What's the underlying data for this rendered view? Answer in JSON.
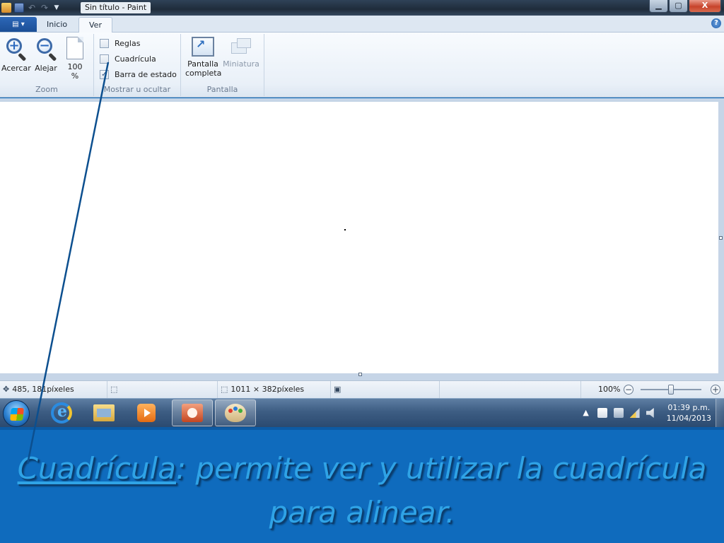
{
  "window": {
    "title": "Sin título - Paint",
    "controls": {
      "minimize": "▁",
      "maximize": "▢",
      "close": "X"
    }
  },
  "ribbon": {
    "tabs": [
      {
        "label": "Inicio"
      },
      {
        "label": "Ver"
      }
    ],
    "groups": {
      "zoom": {
        "label": "Zoom",
        "buttons": [
          {
            "label": "Acercar",
            "icon": "zoom-in-icon"
          },
          {
            "label": "Alejar",
            "icon": "zoom-out-icon"
          },
          {
            "label_line1": "100",
            "label_line2": "%",
            "icon": "actual-size-icon"
          }
        ]
      },
      "show_hide": {
        "label": "Mostrar u ocultar",
        "checkboxes": [
          {
            "label": "Reglas",
            "checked": false
          },
          {
            "label": "Cuadrícula",
            "checked": false
          },
          {
            "label": "Barra de estado",
            "checked": true
          }
        ]
      },
      "screen": {
        "label": "Pantalla",
        "buttons": [
          {
            "label_line1": "Pantalla",
            "label_line2": "completa",
            "icon": "fullscreen-icon",
            "enabled": true
          },
          {
            "label": "Miniatura",
            "icon": "thumbnail-icon",
            "enabled": false
          }
        ]
      }
    }
  },
  "statusbar": {
    "cursor_position": "485, 181píxeles",
    "selection_size": "",
    "image_size": "1011 × 382píxeles",
    "zoom_label": "100%",
    "zoom_fraction": 0.5
  },
  "taskbar": {
    "apps": [
      {
        "name": "internet-explorer"
      },
      {
        "name": "windows-explorer"
      },
      {
        "name": "media-player"
      },
      {
        "name": "powerpoint"
      },
      {
        "name": "paint",
        "active": true
      }
    ],
    "clock": {
      "time": "01:39 p.m.",
      "date": "11/04/2013"
    }
  },
  "slide": {
    "term": "Cuadrícula",
    "separator": ":",
    "description": " permite ver y utilizar la cuadrícula para alinear."
  },
  "colors": {
    "slide_background": "#0f6bbd",
    "caption_text": "#2fa3e6",
    "pointer_line": "#0c4f8f"
  }
}
